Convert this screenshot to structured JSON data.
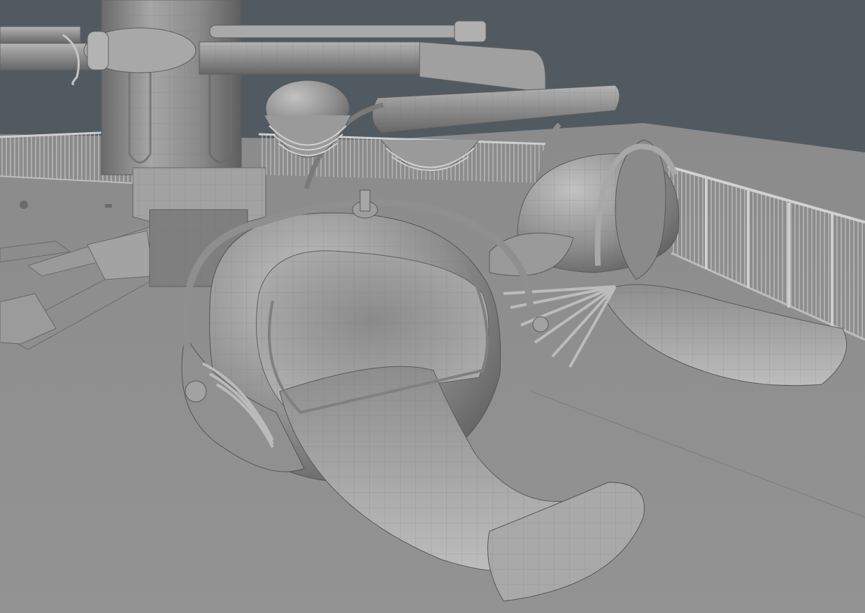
{
  "viewport": {
    "background_color": "#525a61",
    "ground_color": "#8f8f8f",
    "model_color": "#9c9c9c",
    "wire_color": "#6e6e6e"
  },
  "scene": {
    "objects": [
      "ground-plane",
      "fence-railing",
      "central-tower",
      "rotor-arm",
      "base-leg",
      "ride-car"
    ]
  }
}
